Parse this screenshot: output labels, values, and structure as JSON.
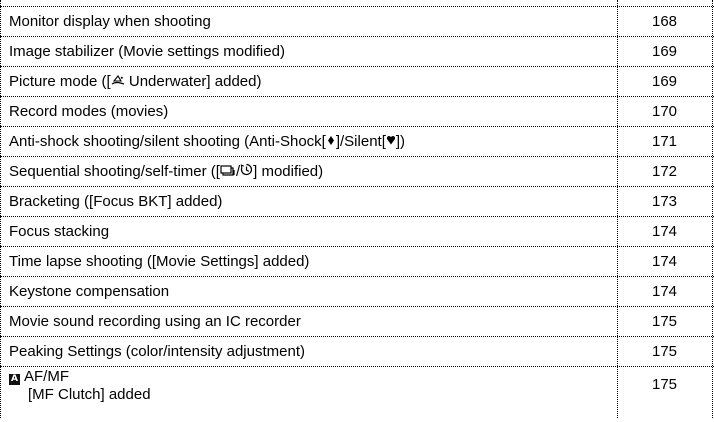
{
  "toc": {
    "items": [
      {
        "title": "Monitor display when shooting",
        "page": "168"
      },
      {
        "title": "Image stabilizer (Movie settings modified)",
        "page": "169"
      },
      {
        "title_prefix": "Picture mode ([",
        "icon": "underwater-icon",
        "title_suffix": " Underwater] added)",
        "page": "169"
      },
      {
        "title": "Record modes (movies)",
        "page": "170"
      },
      {
        "title_prefix": "Anti-shock shooting/silent shooting (Anti-Shock[",
        "icon1": "anti-shock-icon",
        "title_mid": "]/Silent[",
        "icon2": "silent-icon",
        "title_suffix": "])",
        "page": "171"
      },
      {
        "title_prefix": "Sequential shooting/self-timer ([",
        "icon1": "sequential-icon",
        "title_mid": "/",
        "icon2": "self-timer-icon",
        "title_suffix": "] modified)",
        "page": "172"
      },
      {
        "title": "Bracketing ([Focus BKT] added)",
        "page": "173"
      },
      {
        "title": "Focus stacking",
        "page": "174"
      },
      {
        "title": "Time lapse shooting ([Movie Settings] added)",
        "page": "174"
      },
      {
        "title": "Keystone compensation",
        "page": "174"
      },
      {
        "title": "Movie sound recording using an IC recorder",
        "page": "175"
      },
      {
        "title": "Peaking Settings (color/intensity adjustment)",
        "page": "175"
      },
      {
        "icon": "af-mf-mode-icon",
        "title_line1": "AF/MF",
        "title_line2": "[MF Clutch] added",
        "page": "175"
      }
    ]
  }
}
